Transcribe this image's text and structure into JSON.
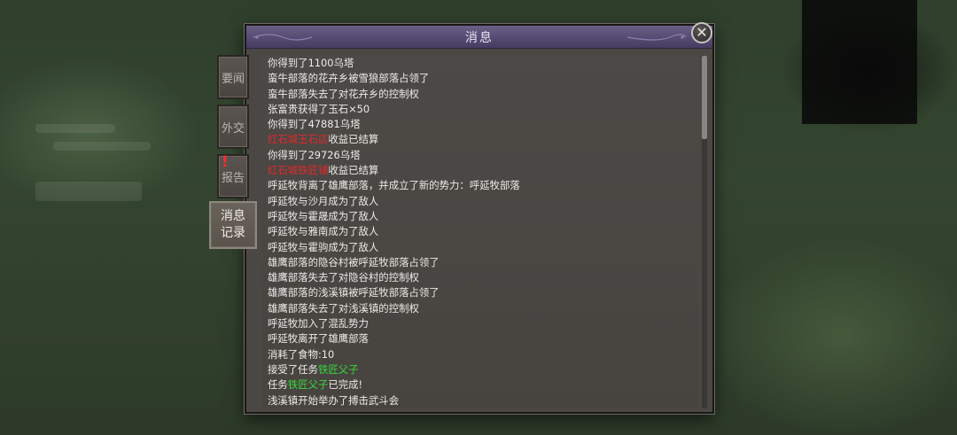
{
  "dialog": {
    "title": "消息",
    "close_label": "✕"
  },
  "tabs": [
    {
      "label": "要闻",
      "active": false
    },
    {
      "label": "外交",
      "active": false
    },
    {
      "label": "报告",
      "active": false,
      "alert": "!"
    },
    {
      "label_line1": "消息",
      "label_line2": "记录",
      "active": true
    }
  ],
  "log": [
    [
      {
        "t": "你得到了1100乌塔"
      }
    ],
    [
      {
        "t": "蛮牛部落的花卉乡被雪狼部落占领了"
      }
    ],
    [
      {
        "t": "蛮牛部落失去了对花卉乡的控制权"
      }
    ],
    [
      {
        "t": "张富贵获得了玉石×50"
      }
    ],
    [
      {
        "t": "你得到了47881乌塔"
      }
    ],
    [
      {
        "t": "红石城玉石店",
        "c": "red"
      },
      {
        "t": "收益已结算"
      }
    ],
    [
      {
        "t": "你得到了29726乌塔"
      }
    ],
    [
      {
        "t": "红石城铁匠铺",
        "c": "red"
      },
      {
        "t": "收益已结算"
      }
    ],
    [
      {
        "t": "呼延牧背离了雄鹰部落，并成立了新的势力：呼延牧部落"
      }
    ],
    [
      {
        "t": "呼延牧与沙月成为了敌人"
      }
    ],
    [
      {
        "t": "呼延牧与霍晟成为了敌人"
      }
    ],
    [
      {
        "t": "呼延牧与雅南成为了敌人"
      }
    ],
    [
      {
        "t": "呼延牧与霍驹成为了敌人"
      }
    ],
    [
      {
        "t": "雄鹰部落的隐谷村被呼延牧部落占领了"
      }
    ],
    [
      {
        "t": "雄鹰部落失去了对隐谷村的控制权"
      }
    ],
    [
      {
        "t": "雄鹰部落的浅溪镇被呼延牧部落占领了"
      }
    ],
    [
      {
        "t": "雄鹰部落失去了对浅溪镇的控制权"
      }
    ],
    [
      {
        "t": "呼延牧加入了混乱势力"
      }
    ],
    [
      {
        "t": "呼延牧离开了雄鹰部落"
      }
    ],
    [
      {
        "t": "消耗了食物:10"
      }
    ],
    [
      {
        "t": "接受了任务"
      },
      {
        "t": "铁匠父子",
        "c": "green"
      }
    ],
    [
      {
        "t": "任务"
      },
      {
        "t": "铁匠父子",
        "c": "green"
      },
      {
        "t": "已完成!"
      }
    ],
    [
      {
        "t": "浅溪镇开始举办了搏击武斗会"
      }
    ]
  ],
  "colors": {
    "red": "#e02a2a",
    "green": "#35d83a",
    "title_bar": "#564b72"
  }
}
